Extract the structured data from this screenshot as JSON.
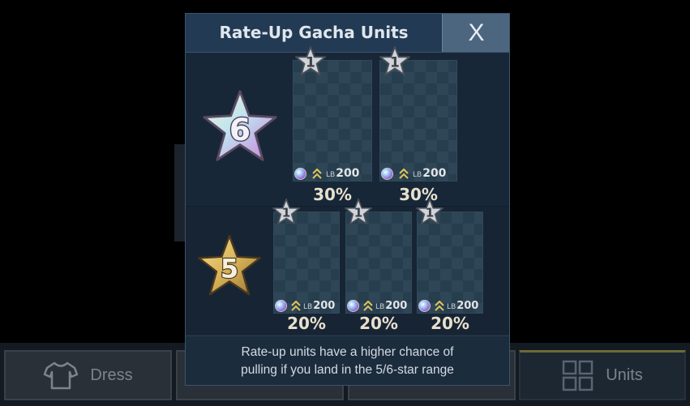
{
  "modal": {
    "title": "Rate-Up Gacha Units",
    "close_label": "X",
    "footer": {
      "line1": "Rate-up units have a higher chance of",
      "line2": "pulling if you land in the 5/6-star range"
    }
  },
  "tiers": [
    {
      "rank": "6",
      "units": [
        {
          "count": "1",
          "lb_label": "LB",
          "lb_value": "200",
          "rate": "30%"
        },
        {
          "count": "1",
          "lb_label": "LB",
          "lb_value": "200",
          "rate": "30%"
        }
      ]
    },
    {
      "rank": "5",
      "units": [
        {
          "count": "1",
          "lb_label": "LB",
          "lb_value": "200",
          "rate": "20%"
        },
        {
          "count": "1",
          "lb_label": "LB",
          "lb_value": "200",
          "rate": "20%"
        },
        {
          "count": "1",
          "lb_label": "LB",
          "lb_value": "200",
          "rate": "20%"
        }
      ]
    }
  ],
  "bottom_nav": {
    "dress": {
      "label": "Dress",
      "icon": "shirt-icon"
    },
    "units": {
      "label": "Units",
      "icon": "grid-icon"
    }
  },
  "colors": {
    "rank6_star": "#d8e8f0",
    "rank5_star": "#d9b45a",
    "accent_gold": "#e8e0cc"
  }
}
